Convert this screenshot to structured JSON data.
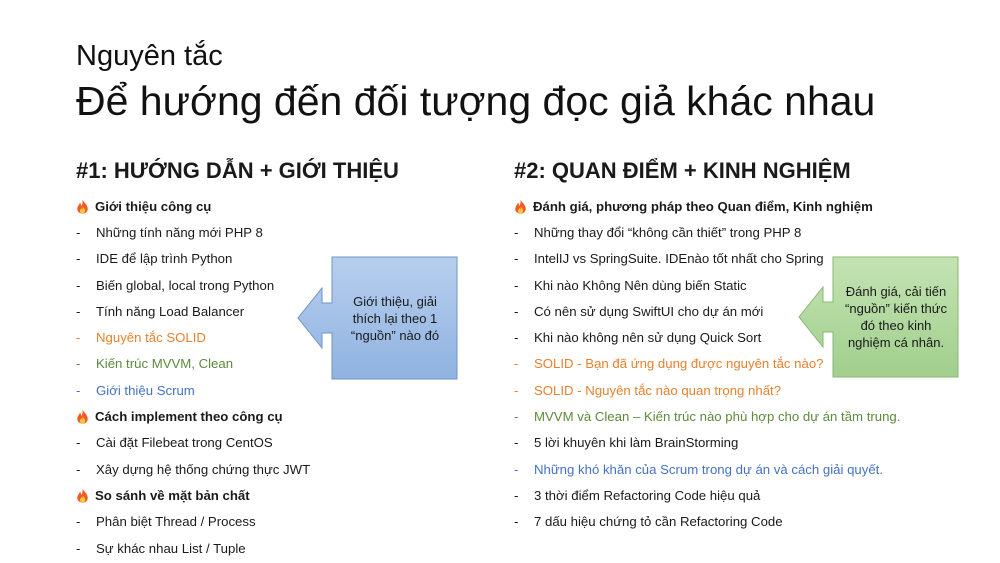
{
  "subtitle": "Nguyên tắc",
  "title": "Để hướng đến đối tượng đọc giả khác nhau",
  "colors": {
    "orange": "#e8812e",
    "green": "#5d8a3b",
    "blue": "#4472c4",
    "callout_blue_fill": "#a7c3e8",
    "callout_green_fill": "#b3d9a0"
  },
  "left": {
    "heading": "#1: HƯỚNG DẪN + GIỚI THIỆU",
    "items": [
      {
        "type": "group",
        "icon": "fire-icon",
        "text": "Giới thiệu công cụ",
        "color": "default"
      },
      {
        "type": "item",
        "dash": "-",
        "text": "Những tính năng mới PHP 8",
        "color": "default"
      },
      {
        "type": "item",
        "dash": "-",
        "text": "IDE để lập trình Python",
        "color": "default"
      },
      {
        "type": "item",
        "dash": "-",
        "text": "Biến global, local trong Python",
        "color": "default"
      },
      {
        "type": "item",
        "dash": "-",
        "text": "Tính năng Load Balancer",
        "color": "default"
      },
      {
        "type": "item",
        "dash": "-",
        "text": "Nguyên tắc SOLID",
        "color": "orange"
      },
      {
        "type": "item",
        "dash": "-",
        "text": "Kiến trúc MVVM, Clean",
        "color": "green"
      },
      {
        "type": "item",
        "dash": "-",
        "text": "Giới thiệu Scrum",
        "color": "blue"
      },
      {
        "type": "group",
        "icon": "fire-icon",
        "text": "Cách implement theo công cụ",
        "color": "default"
      },
      {
        "type": "item",
        "dash": "-",
        "text": "Cài đặt Filebeat trong CentOS",
        "color": "default"
      },
      {
        "type": "item",
        "dash": "-",
        "text": "Xây dựng hệ thống chứng thực JWT",
        "color": "default"
      },
      {
        "type": "group",
        "icon": "fire-icon",
        "text": "So sánh về mặt bản chất",
        "color": "default"
      },
      {
        "type": "item",
        "dash": "-",
        "text": "Phân biệt Thread / Process",
        "color": "default"
      },
      {
        "type": "item",
        "dash": "-",
        "text": "Sự khác nhau List / Tuple",
        "color": "default"
      }
    ],
    "callout": {
      "lines": [
        "Giới thiệu, giải",
        "thích lại theo 1",
        "“nguồn” nào đó"
      ]
    }
  },
  "right": {
    "heading": "#2: QUAN ĐIỂM + KINH NGHIỆM",
    "items": [
      {
        "type": "group",
        "icon": "fire-icon",
        "text": "Đánh giá, phương pháp theo Quan điểm, Kinh nghiệm",
        "color": "default"
      },
      {
        "type": "item",
        "dash": "-",
        "text": "Những thay đổi “không cần thiết” trong PHP 8",
        "color": "default"
      },
      {
        "type": "item",
        "dash": "-",
        "text": "IntelIJ vs SpringSuite. IDEnào tốt nhất cho Spring",
        "color": "default"
      },
      {
        "type": "item",
        "dash": "-",
        "text": "Khi nào Không Nên dùng biến Static",
        "color": "default"
      },
      {
        "type": "item",
        "dash": "-",
        "text": "Có nên sử dụng SwiftUI cho dự án mới",
        "color": "default"
      },
      {
        "type": "item",
        "dash": "-",
        "text": "Khi nào không nên sử dụng Quick Sort",
        "color": "default"
      },
      {
        "type": "item",
        "dash": "-",
        "text": "SOLID - Bạn đã ứng dụng được nguyên tắc nào?",
        "color": "orange"
      },
      {
        "type": "item",
        "dash": "-",
        "text": "SOLID - Nguyên tắc nào quan trọng nhất?",
        "color": "orange"
      },
      {
        "type": "item",
        "dash": "-",
        "text": "MVVM và Clean – Kiến trúc nào phù hợp cho dự án tầm trung.",
        "color": "green"
      },
      {
        "type": "item",
        "dash": "-",
        "text": "5 lời khuyên khi làm BrainStorming",
        "color": "default"
      },
      {
        "type": "item",
        "dash": "-",
        "text": "Những khó khăn của Scrum trong dự án và cách giải quyết.",
        "color": "blue"
      },
      {
        "type": "item",
        "dash": "-",
        "text": "3 thời điểm Refactoring Code hiệu quả",
        "color": "default"
      },
      {
        "type": "item",
        "dash": "-",
        "text": "7 dấu hiệu chứng tỏ cần Refactoring Code",
        "color": "default"
      }
    ],
    "callout": {
      "lines": [
        "Đánh giá, cải tiến",
        "“nguồn” kiến thức",
        "đó theo kinh",
        "nghiệm cá nhân."
      ]
    }
  }
}
